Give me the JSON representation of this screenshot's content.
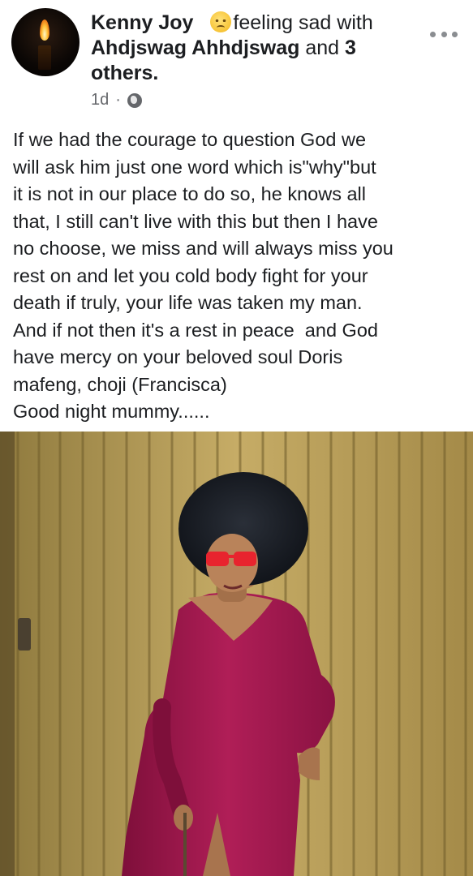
{
  "post": {
    "author": "Kenny Joy",
    "feeling_text": "feeling sad with",
    "tagged_name": "Ahdjswag Ahhdjswag",
    "and_text": "and",
    "others_count": "3",
    "others_suffix": "others.",
    "time": "1d",
    "separator": "·",
    "privacy_icon": "globe-icon",
    "feeling_icon": "sad-face-emoji",
    "menu_icon": "more-options-icon",
    "body": "If we had the courage to question God we\nwill ask him just one word which is\"why\"but\nit is not in our place to do so, he knows all\nthat, I still can't live with this but then I have\nno choose, we miss and will always miss you\nrest on and let you cold body fight for your\ndeath if truly, your life was taken my man.\nAnd if not then it's a rest in peace  and God\nhave mercy on your beloved soul Doris\nmafeng, choji (Francisca)\nGood night mummy......"
  },
  "colors": {
    "text_primary": "#1c1e21",
    "text_secondary": "#65676b",
    "dress": "#a3184e",
    "wall": "#b59a52",
    "glasses": "#e8242e"
  }
}
